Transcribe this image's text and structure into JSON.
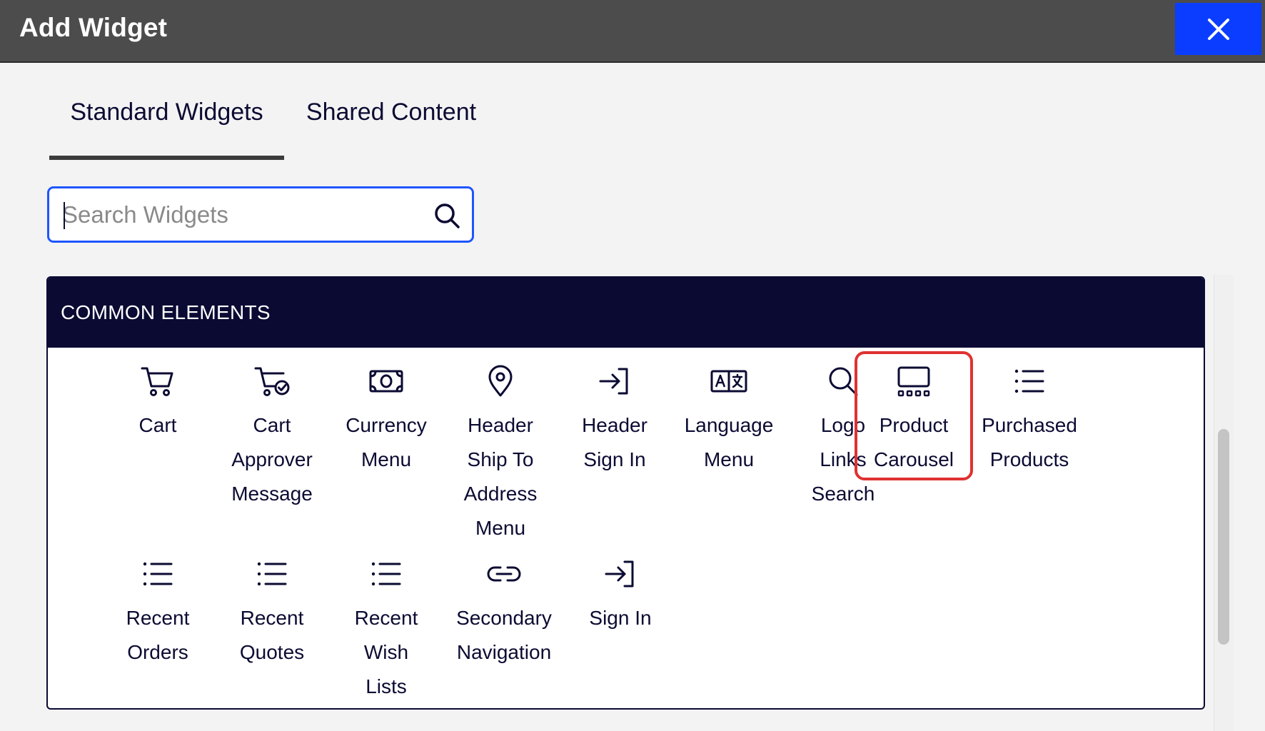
{
  "dialog": {
    "title": "Add Widget",
    "close_label": "Close"
  },
  "tabs": [
    {
      "label": "Standard Widgets",
      "active": true
    },
    {
      "label": "Shared Content",
      "active": false
    }
  ],
  "search": {
    "placeholder": "Search Widgets",
    "value": ""
  },
  "section": {
    "title": "COMMON ELEMENTS",
    "widgets": [
      {
        "icon": "cart-icon",
        "label_lines": [
          "Cart"
        ]
      },
      {
        "icon": "cart-check-icon",
        "label_lines": [
          "Cart",
          "Approver",
          "Message"
        ]
      },
      {
        "icon": "currency-icon",
        "label_lines": [
          "Currency",
          "Menu"
        ]
      },
      {
        "icon": "map-pin-icon",
        "label_lines": [
          "Header",
          "Ship To",
          "Address",
          "Menu"
        ]
      },
      {
        "icon": "sign-in-icon",
        "label_lines": [
          "Header",
          "Sign In"
        ]
      },
      {
        "icon": "language-icon",
        "label_lines": [
          "Language",
          "Menu"
        ]
      },
      {
        "icon": "search-icon",
        "label_lines": [
          "Logo",
          "Links",
          "Search"
        ]
      },
      {
        "icon": "carousel-icon",
        "label_lines": [
          "Product",
          "Carousel"
        ],
        "highlighted": true
      },
      {
        "icon": "list-icon",
        "label_lines": [
          "Purchased",
          "Products"
        ]
      },
      {
        "icon": "list-icon",
        "label_lines": [
          "Recent",
          "Orders"
        ]
      },
      {
        "icon": "list-icon",
        "label_lines": [
          "Recent",
          "Quotes"
        ]
      },
      {
        "icon": "list-icon",
        "label_lines": [
          "Recent",
          "Wish",
          "Lists"
        ]
      },
      {
        "icon": "link-icon",
        "label_lines": [
          "Secondary",
          "Navigation"
        ]
      },
      {
        "icon": "sign-in-icon",
        "label_lines": [
          "Sign In"
        ]
      }
    ]
  },
  "colors": {
    "titlebar": "#4c4c4c",
    "close_button": "#0a3dff",
    "section_header": "#0a0a33",
    "search_border": "#1f55ff",
    "highlight": "#e03131"
  }
}
